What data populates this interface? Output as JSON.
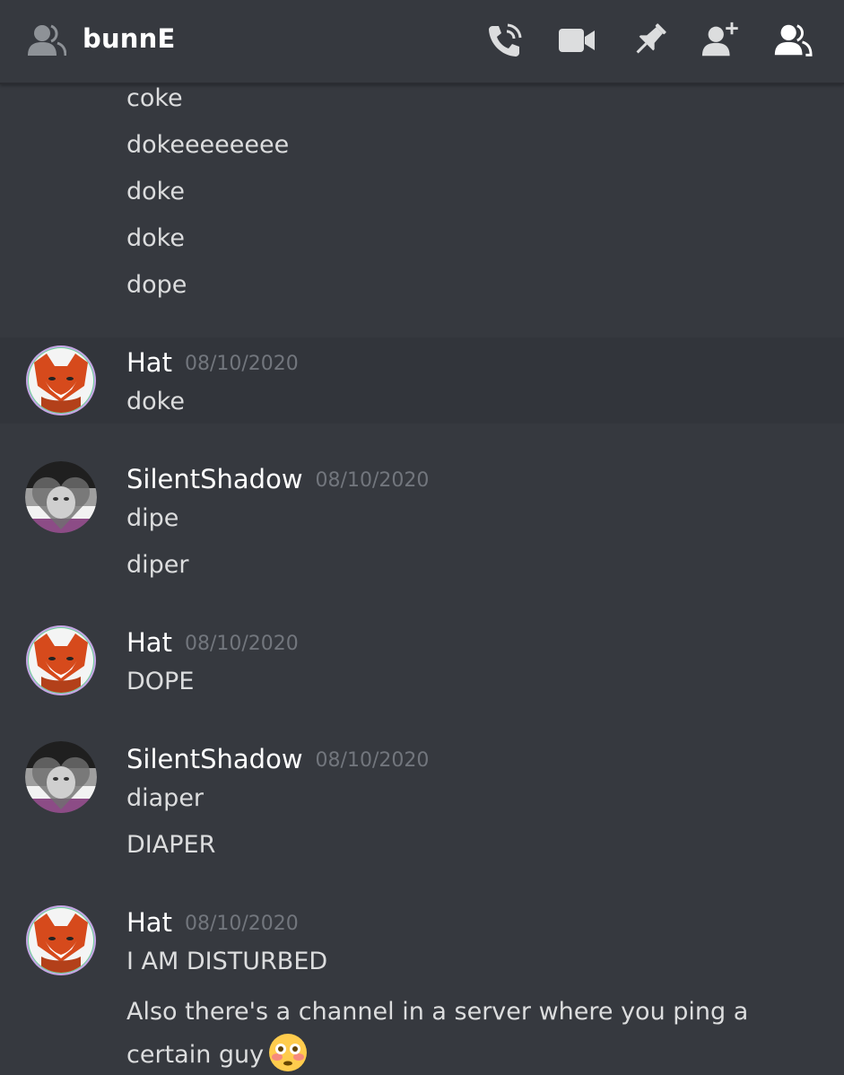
{
  "header": {
    "title": "bunnE",
    "icons": [
      "user-icon",
      "call-icon",
      "video-icon",
      "pin-icon",
      "add-friend-icon",
      "member-list-icon"
    ]
  },
  "colors": {
    "background": "#36393f",
    "highlight": "#32353b",
    "timestamp": "#72767d",
    "text": "#dcddde"
  },
  "messages": {
    "continuation": [
      "coke",
      "dokeeeeeeee",
      "doke",
      "doke",
      "dope"
    ],
    "groups": [
      {
        "author": "Hat",
        "timestamp": "08/10/2020",
        "lines": [
          "doke"
        ]
      },
      {
        "author": "SilentShadow",
        "timestamp": "08/10/2020",
        "lines": [
          "dipe",
          "diper"
        ]
      },
      {
        "author": "Hat",
        "timestamp": "08/10/2020",
        "lines": [
          "DOPE"
        ]
      },
      {
        "author": "SilentShadow",
        "timestamp": "08/10/2020",
        "lines": [
          "diaper",
          "DIAPER"
        ]
      },
      {
        "author": "Hat",
        "timestamp": "08/10/2020",
        "lines": [
          "I AM DISTURBED",
          "Also there's a channel in a server where you ping a certain guy"
        ],
        "emoji": "flushed-face"
      }
    ]
  }
}
